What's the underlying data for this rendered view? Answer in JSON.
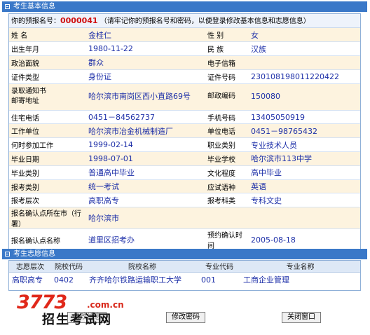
{
  "basic_section": {
    "title": "考生基本信息",
    "notice_label": "你的预报名号：",
    "reg_number": "0000041",
    "notice_text": "（请牢记你的预报名号和密码，以便登录修改基本信息和志愿信息）",
    "rows": [
      {
        "l1": "姓  名",
        "v1": "金桂仁",
        "l2": "性  别",
        "v2": "女"
      },
      {
        "l1": "出生年月",
        "v1": "1980-11-22",
        "l2": "民  族",
        "v2": "汉族"
      },
      {
        "l1": "政治面貌",
        "v1": "群众",
        "l2": "电子信箱",
        "v2": ""
      },
      {
        "l1": "证件类型",
        "v1": "身份证",
        "l2": "证件号码",
        "v2": "230108198011220422"
      },
      {
        "l1": "录取通知书\n邮寄地址",
        "v1": "哈尔滨市南岗区西小直路69号",
        "l2": "邮政编码",
        "v2": "150080"
      },
      {
        "l1": "住宅电话",
        "v1": "0451－84562737",
        "l2": "手机号码",
        "v2": "13405050919"
      },
      {
        "l1": "工作单位",
        "v1": "哈尔滨市冶金机械制造厂",
        "l2": "单位电话",
        "v2": "0451－98765432"
      },
      {
        "l1": "何时参加工作",
        "v1": "1999-02-14",
        "l2": "职业类别",
        "v2": "专业技术人员"
      },
      {
        "l1": "毕业日期",
        "v1": "1998-07-01",
        "l2": "毕业学校",
        "v2": "哈尔滨市113中学"
      },
      {
        "l1": "毕业类别",
        "v1": "普通高中毕业",
        "l2": "文化程度",
        "v2": "高中毕业"
      },
      {
        "l1": "报考类别",
        "v1": "统一考试",
        "l2": "应试语种",
        "v2": "英语"
      },
      {
        "l1": "报考层次",
        "v1": "高职高专",
        "l2": "报考科类",
        "v2": "专科文史"
      },
      {
        "l1": "报名确认点所在市（行署）",
        "v1": "哈尔滨市",
        "l2": "",
        "v2": ""
      },
      {
        "l1": "报名确认点名称",
        "v1": "道里区招考办",
        "l2": "预约确认时间",
        "v2": "2005-08-18"
      }
    ]
  },
  "wish_section": {
    "title": "考生志愿信息",
    "headers": [
      "志愿层次",
      "院校代码",
      "院校名称",
      "专业代码",
      "专业名称"
    ],
    "rows": [
      [
        "高职高专",
        "0402",
        "齐齐哈尔铁路运输职工大学",
        "001",
        "工商企业管理"
      ]
    ]
  },
  "buttons": {
    "hidden": "修改信息",
    "change_password": "修改密码",
    "close_window": "关闭窗口"
  },
  "watermark": {
    "logo": "3773",
    "domain": ".com.cn",
    "text": "招生考试网"
  },
  "colors": {
    "header_bg": "#3a78c8",
    "row_alt_bg": "#fdf3df",
    "value_text": "#1d2fa8",
    "reg_number": "#d01010"
  }
}
